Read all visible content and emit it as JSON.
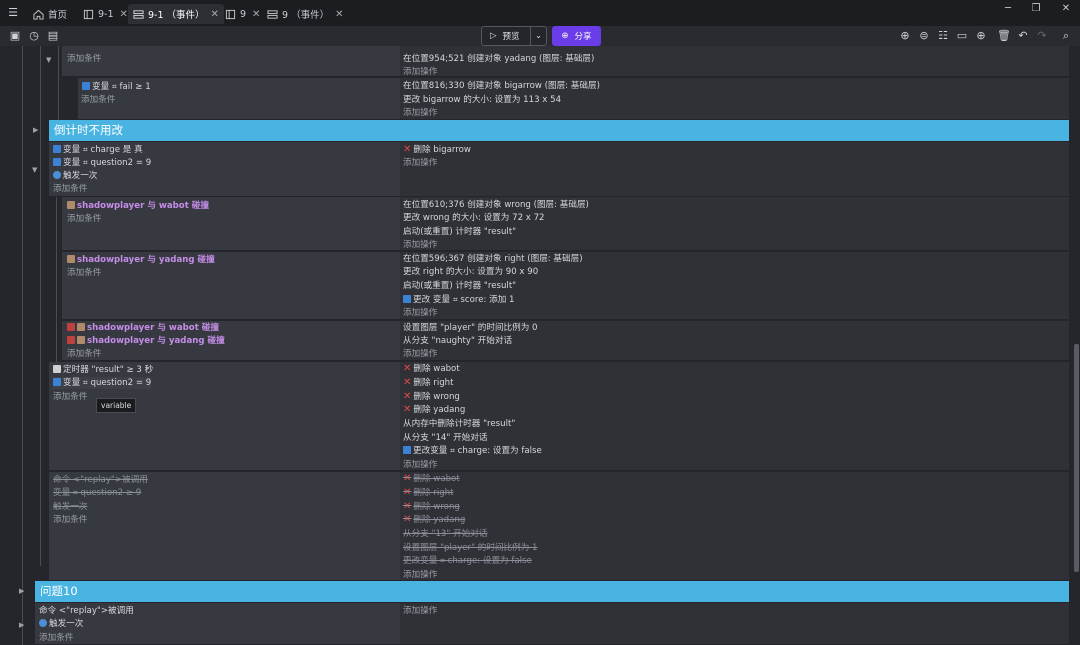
{
  "tabs": [
    {
      "label": "首页",
      "icon": "home-icon"
    },
    {
      "label": "9-1",
      "icon": "layout-icon"
    },
    {
      "label": "9-1 （事件）",
      "icon": "events-icon"
    },
    {
      "label": "9",
      "icon": "layout-icon"
    },
    {
      "label": "9 （事件）",
      "icon": "events-icon"
    }
  ],
  "toolbar": {
    "preview_label": "预览",
    "share_label": "分享"
  },
  "group_timer": {
    "title": "倒计时不用改"
  },
  "group_q10": {
    "title": "问题10"
  },
  "common": {
    "add_condition": "添加条件",
    "add_action": "添加操作"
  },
  "rows": {
    "r0_cond": "变量 ⌗ fail ≥ 1",
    "r0_act1": "在位置954;521 创建对象 yadang (图层: 基础层)",
    "r1_act1": "在位置816;330 创建对象 bigarrow (图层: 基础层)",
    "r1_act2": "更改 bigarrow 的大小: 设置为 113 x 54",
    "r2_c1": "变量 ⌗ charge 是 真",
    "r2_c2": "变量 ⌗ question2 = 9",
    "r2_c3": "触发一次",
    "r2_a1": "删除 bigarrow",
    "r3_c1": "shadowplayer 与 wabot 碰撞",
    "r3_a1": "在位置610;376 创建对象 wrong (图层: 基础层)",
    "r3_a2": "更改 wrong 的大小: 设置为 72 x 72",
    "r3_a3": "启动(或重置) 计时器 \"result\"",
    "r4_c1": "shadowplayer 与 yadang 碰撞",
    "r4_a1": "在位置596;367 创建对象 right (图层: 基础层)",
    "r4_a2": "更改 right 的大小: 设置为 90 x 90",
    "r4_a3": "启动(或重置) 计时器 \"result\"",
    "r4_a4": "更改 变量 ⌗ score: 添加 1",
    "r5_c1": "shadowplayer 与 wabot 碰撞",
    "r5_c2": "shadowplayer 与 yadang 碰撞",
    "r5_a1": "设置图层 \"player\" 的时间比例为 0",
    "r5_a2": "从分支 \"naughty\" 开始对话",
    "r6_c1": "定时器 \"result\" ≥ 3 秒",
    "r6_c2": "变量 ⌗ question2 = 9",
    "r6_a1": "删除 wabot",
    "r6_a2": "删除 right",
    "r6_a3": "删除 wrong",
    "r6_a4": "删除 yadang",
    "r6_a5": "从内存中删除计时器 \"result\"",
    "r6_a6": "从分支 \"14\" 开始对话",
    "r6_a7": "更改变量 ⌗ charge: 设置为 false",
    "r7_c1": "命令 <\"replay\">被调用",
    "r7_c2": "变量 ⌗ question2 ≥ 9",
    "r7_c3": "触发一次",
    "r7_a1": "删除 wabot",
    "r7_a2": "删除 right",
    "r7_a3": "删除 wrong",
    "r7_a4": "删除 yadang",
    "r7_a5": "从分支 \"13\" 开始对话",
    "r7_a6": "设置图层 \"player\" 的时间比例为 1",
    "r7_a7": "更改变量 ⌗ charge: 设置为 false",
    "r8_c1": "命令 <\"replay\">被调用",
    "r8_c2": "触发一次"
  },
  "tooltip": "variable",
  "colors": {
    "accent": "#49b4e2",
    "share": "#6a3de8",
    "delete": "#e04848"
  }
}
